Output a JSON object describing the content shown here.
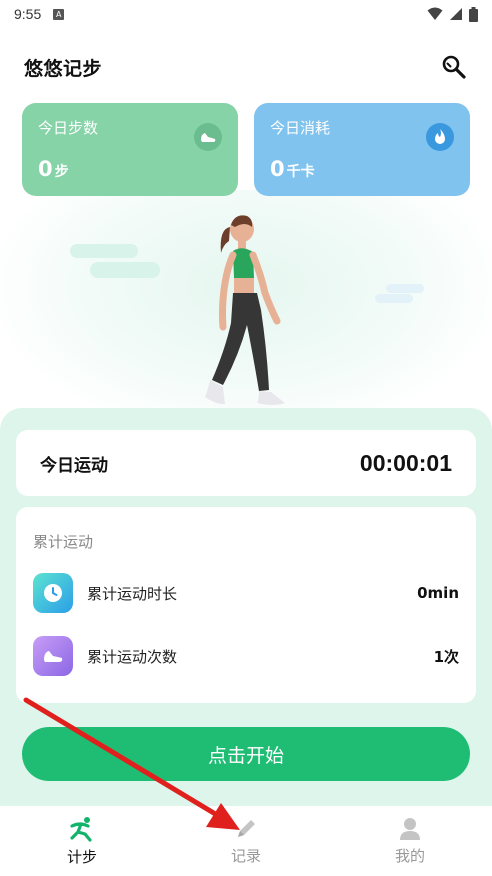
{
  "status_bar": {
    "time": "9:55",
    "badge": "A"
  },
  "header": {
    "title": "悠悠记步",
    "settings_icon": "wrench-search-icon"
  },
  "stats": {
    "steps": {
      "label": "今日步数",
      "value": "0",
      "unit": "步",
      "icon": "shoe-icon"
    },
    "calories": {
      "label": "今日消耗",
      "value": "0",
      "unit": "千卡",
      "icon": "flame-icon"
    }
  },
  "today": {
    "label": "今日运动",
    "time": "00:00:01"
  },
  "cumulative": {
    "title": "累计运动",
    "rows": [
      {
        "label": "累计运动时长",
        "value": "0min",
        "icon": "clock-icon"
      },
      {
        "label": "累计运动次数",
        "value": "1次",
        "icon": "shoe-icon"
      }
    ]
  },
  "start_button": {
    "label": "点击开始"
  },
  "tabs": [
    {
      "label": "计步",
      "icon": "runner-icon",
      "active": true
    },
    {
      "label": "记录",
      "icon": "pencil-icon",
      "active": false
    },
    {
      "label": "我的",
      "icon": "person-icon",
      "active": false
    }
  ],
  "colors": {
    "steps_card": "#86d3a8",
    "calories_card": "#80c3ee",
    "accent_green": "#1fbd74",
    "panel_bg": "#def5ec",
    "annotation_arrow": "#e0201c"
  }
}
